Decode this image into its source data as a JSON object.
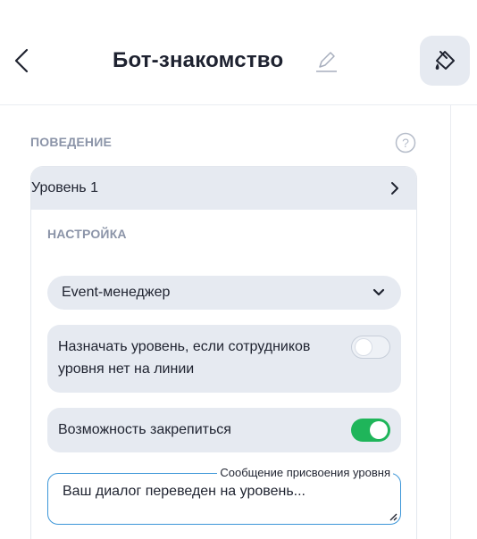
{
  "header": {
    "title": "Бот-знакомство",
    "back_icon": "chevron-left-icon",
    "edit_icon": "pencil-icon",
    "paint_icon": "paint-bucket-icon"
  },
  "behavior": {
    "section_label": "ПОВЕДЕНИЕ",
    "help_icon": "question-circle-icon",
    "level_label": "Уровень 1",
    "settings_label": "НАСТРОЙКА",
    "role_select": {
      "value": "Event-менеджер"
    },
    "assign_level": {
      "label": "Назначать уровень, если сотрудников уровня нет на линии",
      "enabled": false
    },
    "pin_option": {
      "label": "Возможность закрепиться",
      "enabled": true
    },
    "message_field": {
      "legend": "Сообщение присвоения уровня",
      "value": "Ваш диалог переведен на уровень..."
    }
  },
  "colors": {
    "accent_green": "#1fb55a",
    "focus_blue": "#3c96d8",
    "panel_gray": "#e6eaf1",
    "muted_label": "#8b94a8"
  }
}
